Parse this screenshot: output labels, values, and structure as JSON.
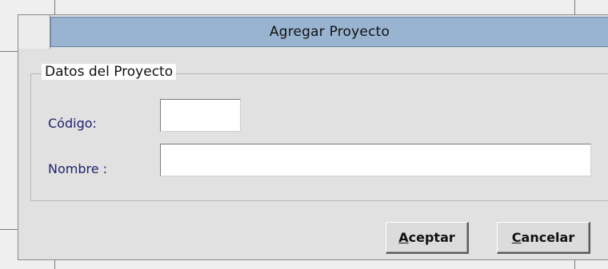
{
  "dialog": {
    "title": "Agregar Proyecto"
  },
  "group": {
    "legend": "Datos del Proyecto"
  },
  "fields": {
    "codigo_label": "Código:",
    "codigo_value": "",
    "nombre_label": "Nombre :",
    "nombre_value": ""
  },
  "buttons": {
    "aceptar_mnemonic": "A",
    "aceptar_rest": "ceptar",
    "cancelar_mnemonic": "C",
    "cancelar_rest": "ancelar"
  },
  "colors": {
    "titlebar": "#99b4d1",
    "dialog_bg": "#e1e1e1",
    "label_text": "#1f1f6e"
  }
}
